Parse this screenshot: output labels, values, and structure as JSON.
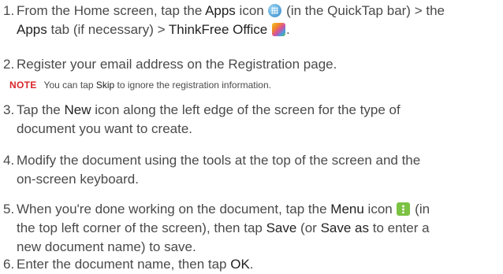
{
  "steps": [
    {
      "number": "1.",
      "p1": "From the Home screen, tap the ",
      "b1": "Apps",
      "p2": " icon ",
      "p3": " (in the QuickTap bar) > the",
      "b2": "Apps",
      "p4": " tab (if necessary) > ",
      "b3": "ThinkFree Office",
      "p5": "."
    },
    {
      "number": "2.",
      "text": "Register your email address on the Registration page."
    },
    {
      "number": "3.",
      "p1": "Tap the ",
      "b1": "New",
      "p2": " icon along the left edge of the screen for the type of",
      "p3": "document you want to create."
    },
    {
      "number": "4.",
      "p1": "Modify the document using the tools at the top of the screen and the",
      "p2": "on-screen keyboard."
    },
    {
      "number": "5.",
      "p1": "When you're done working on the document, tap the ",
      "b1": "Menu",
      "p2": " icon ",
      "p3": " (in",
      "p4": "the top left corner of the screen), then tap ",
      "b2": "Save",
      "p5": " (or ",
      "b3": "Save as",
      "p6": " to enter a",
      "p7": "new document name) to save."
    },
    {
      "number": "6.",
      "p1": "Enter the document name, then tap ",
      "b1": "OK",
      "p2": "."
    }
  ],
  "note": {
    "label": "NOTE",
    "p1": "You can tap ",
    "b1": "Skip",
    "p2": " to ignore the registration information."
  },
  "icons": {
    "apps": "apps-icon",
    "thinkfree": "thinkfree-office-icon",
    "menu": "menu-icon"
  }
}
